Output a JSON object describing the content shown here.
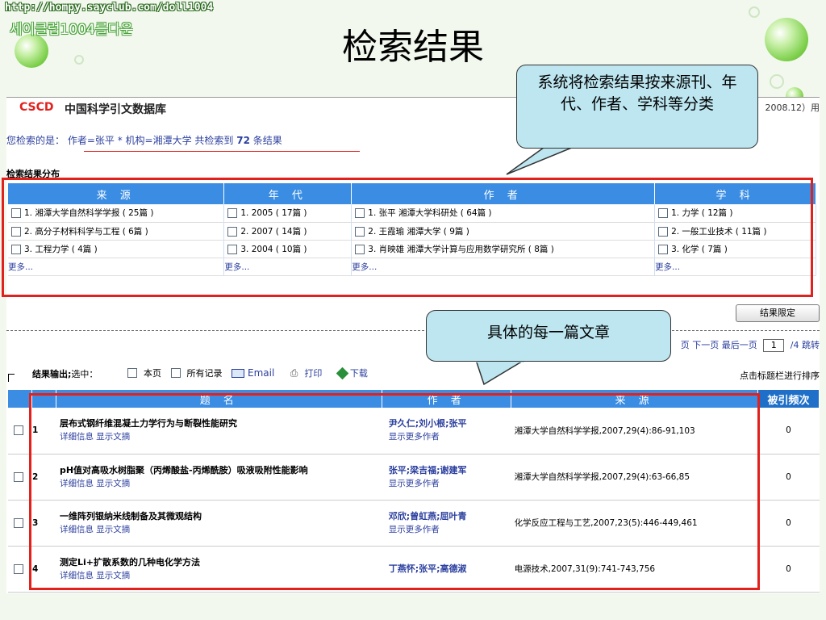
{
  "slide": {
    "url_text": "http://hompy.sayclub.com/doll1004",
    "korean_text": "세이클럽1004를다운",
    "title": "检索结果"
  },
  "app": {
    "logo_cscd": "CSCD",
    "logo_name": "中国科学引文数据库",
    "date_fragment": "2008.12）用"
  },
  "query": {
    "prefix": "您检索的是：",
    "condition": "作者=张平 * 机构=湘潭大学 共检索到",
    "count": "72",
    "suffix": "条结果"
  },
  "distribution": {
    "title": "检索结果分布",
    "columns": [
      "来 源",
      "年 代",
      "作 者",
      "学 科"
    ],
    "rows": [
      [
        "1. 湘潭大学自然科学学报 ( 25篇 )",
        "1. 2005 ( 17篇 )",
        "1. 张平 湘潭大学科研处 ( 64篇 )",
        "1. 力学 ( 12篇 )"
      ],
      [
        "2. 高分子材料科学与工程 ( 6篇 )",
        "2. 2007 ( 14篇 )",
        "2. 王霞瑜 湘潭大学 ( 9篇 )",
        "2. 一般工业技术 ( 11篇 )"
      ],
      [
        "3. 工程力学 ( 4篇 )",
        "3. 2004 ( 10篇 )",
        "3. 肖映雄 湘潭大学计算与应用数学研究所 ( 8篇 )",
        "3. 化学 ( 7篇 )"
      ]
    ],
    "more_label": "更多..."
  },
  "limit_button": "结果限定",
  "pager": {
    "prev_fragment": "页",
    "next": "下一页",
    "last": "最后一页",
    "current_page": "1",
    "total": "/4 跳转"
  },
  "output": {
    "label": "结果输出;",
    "select_label": "选中：",
    "this_page": "本页",
    "all_records": "所有记录",
    "email": "Email",
    "print": "打印",
    "download": "下载",
    "sort_hint": "点击标题栏进行排序"
  },
  "results": {
    "headers": [
      "题 名",
      "作 者",
      "来 源",
      "被引频次"
    ],
    "rows": [
      {
        "num": "1",
        "title": "层布式钢纤维混凝土力学行为与断裂性能研究",
        "links": "详细信息  显示文摘",
        "authors": "尹久仁;刘小根;张平",
        "more_authors": "显示更多作者",
        "source": "湘潭大学自然科学学报,2007,29(4):86-91,103",
        "cited": "0"
      },
      {
        "num": "2",
        "title": "pH值对高吸水树脂聚（丙烯酸盐-丙烯酰胺）吸液吸附性能影响",
        "links": "详细信息  显示文摘",
        "authors": "张平;梁吉福;谢建军",
        "more_authors": "显示更多作者",
        "source": "湘潭大学自然科学学报,2007,29(4):63-66,85",
        "cited": "0"
      },
      {
        "num": "3",
        "title": "一维阵列银纳米线制备及其微观结构",
        "links": "详细信息  显示文摘",
        "authors": "邓欣;曾虹燕;屈叶青",
        "more_authors": "显示更多作者",
        "source": "化学反应工程与工艺,2007,23(5):446-449,461",
        "cited": "0"
      },
      {
        "num": "4",
        "title": "测定Li+扩散系数的几种电化学方法",
        "links": "详细信息  显示文摘",
        "authors": "丁燕怀;张平;高德淑",
        "more_authors": "",
        "source": "电源技术,2007,31(9):741-743,756",
        "cited": "0"
      }
    ]
  },
  "callouts": {
    "top": "系统将检索结果按来源刊、年代、作者、学科等分类",
    "middle": "具体的每一篇文章"
  },
  "colors": {
    "header_blue": "#3a8de3",
    "highlight_red": "#e2211c",
    "callout_fill": "#bde6f0",
    "link_blue": "#2b3f9e"
  }
}
